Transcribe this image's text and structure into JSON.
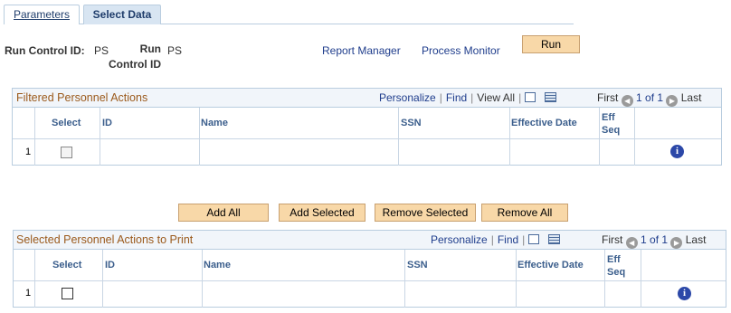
{
  "tabs": [
    {
      "label": "Parameters"
    },
    {
      "label": "Select Data"
    }
  ],
  "header": {
    "run_control_label": "Run Control ID:",
    "run_control_value": "PS",
    "run_label_line1": "Run",
    "run_label_line2": "Control ID",
    "run_value": "PS",
    "report_manager": "Report Manager",
    "process_monitor": "Process Monitor",
    "run_button": "Run"
  },
  "grid1": {
    "title": "Filtered Personnel Actions",
    "personalize": "Personalize",
    "find": "Find",
    "view_all": "View All",
    "first": "First",
    "range": "1 of 1",
    "last": "Last",
    "columns": [
      "Select",
      "ID",
      "Name",
      "SSN",
      "Effective Date",
      "Eff",
      "Seq"
    ],
    "rows": [
      {
        "num": "1",
        "info": "i"
      }
    ]
  },
  "buttons": {
    "add_all": "Add All",
    "add_selected": "Add Selected",
    "remove_selected": "Remove Selected",
    "remove_all": "Remove All"
  },
  "grid2": {
    "title": "Selected Personnel Actions to Print",
    "personalize": "Personalize",
    "find": "Find",
    "first": "First",
    "range": "1 of 1",
    "last": "Last",
    "columns": [
      "Select",
      "ID",
      "Name",
      "SSN",
      "Effective Date",
      "Eff",
      "Seq"
    ],
    "rows": [
      {
        "num": "1",
        "info": "i"
      }
    ]
  },
  "icons": {
    "nav_prev": "circle-left-arrow-icon",
    "nav_next": "circle-right-arrow-icon",
    "zoom": "new-window-icon",
    "download": "download-grid-icon",
    "info": "info-icon"
  },
  "colors": {
    "grid_title": "#9b5a1c",
    "link": "#1f3d8c",
    "button_bg": "#f8d8a8",
    "header_bg": "#f1f5fa",
    "info_icon": "#2c48a8"
  }
}
